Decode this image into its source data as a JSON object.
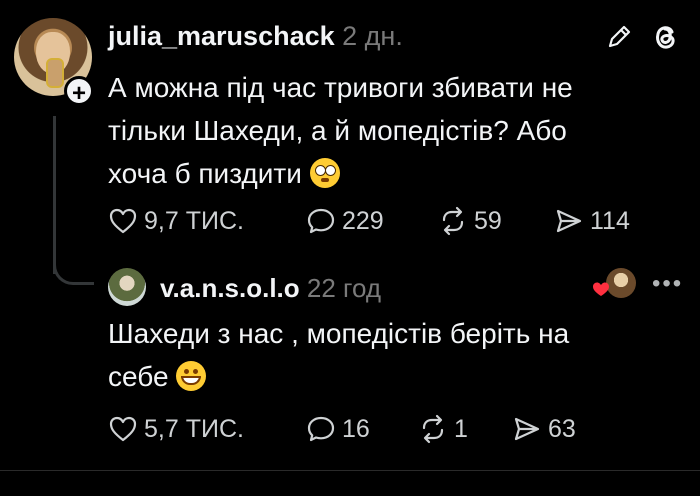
{
  "post": {
    "username": "julia_maruschack",
    "time": "2 дн.",
    "text_line1": "А можна під час тривоги збивати не",
    "text_line2": "тільки Шахеди, а й мопедістів? Або",
    "text_line3": "хоча б пиздити",
    "emoji": "flushed-face",
    "likes": "9,7 ТИС.",
    "comments": "229",
    "reposts": "59",
    "shares": "114"
  },
  "reply": {
    "username": "v.a.n.s.o.l.o",
    "time": "22 год",
    "text_line1": "Шахеди з нас , мопедістів  беріть на",
    "text_line2": "себе",
    "emoji": "grinning-face",
    "likes": "5,7 ТИС.",
    "comments": "16",
    "reposts": "1",
    "shares": "63"
  },
  "icons": {
    "edit": "pencil-icon",
    "app": "threads-icon",
    "like": "heart-icon",
    "comment": "comment-bubble-icon",
    "repost": "repost-icon",
    "share": "send-icon",
    "more": "more-dots-icon"
  },
  "colors": {
    "background": "#000000",
    "text": "#f3f5f7",
    "muted": "#7a7a7a",
    "like_red": "#ff3040"
  }
}
